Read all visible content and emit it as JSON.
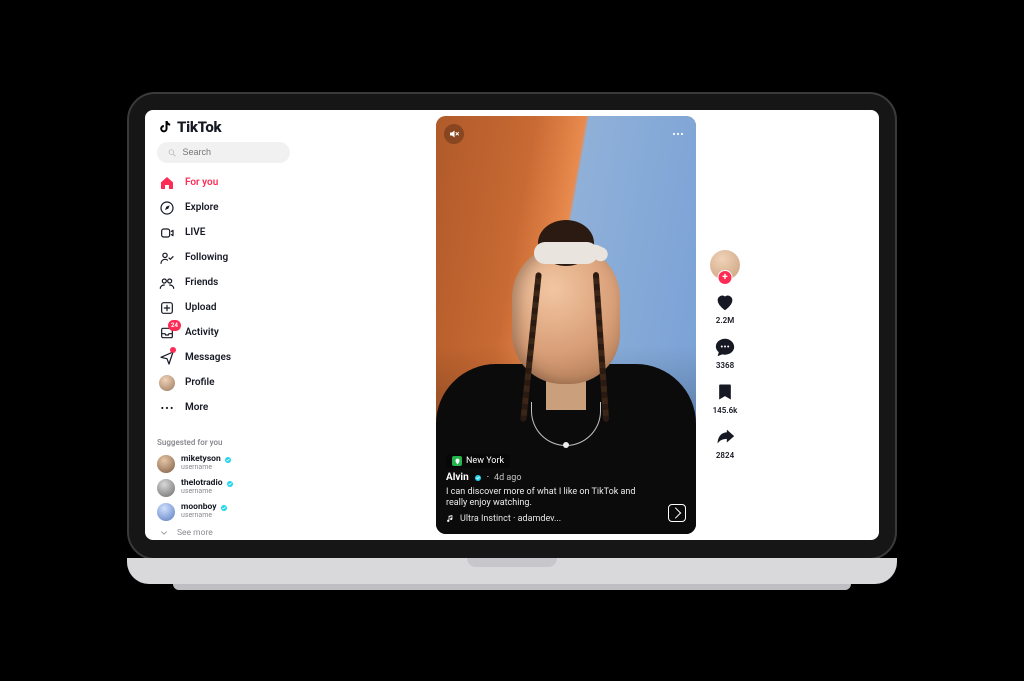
{
  "brand": "TikTok",
  "search": {
    "placeholder": "Search"
  },
  "nav": {
    "for_you": {
      "label": "For you"
    },
    "explore": {
      "label": "Explore"
    },
    "live": {
      "label": "LIVE"
    },
    "following": {
      "label": "Following"
    },
    "friends": {
      "label": "Friends"
    },
    "upload": {
      "label": "Upload"
    },
    "activity": {
      "label": "Activity",
      "badge": "24"
    },
    "messages": {
      "label": "Messages"
    },
    "profile": {
      "label": "Profile"
    },
    "more": {
      "label": "More"
    }
  },
  "suggested": {
    "title": "Suggested for you",
    "items": [
      {
        "name": "miketyson",
        "sub": "username"
      },
      {
        "name": "thelotradio",
        "sub": "username"
      },
      {
        "name": "moonboy",
        "sub": "username"
      }
    ],
    "see_more": "See more"
  },
  "video": {
    "location": "New York",
    "author": "Alvin",
    "time": "4d ago",
    "caption": "I can discover more of what I like on TikTok and really enjoy watching.",
    "sound": "Ultra Instinct · adamdev..."
  },
  "rail": {
    "likes": "2.2M",
    "comments": "3368",
    "saves": "145.6k",
    "shares": "2824"
  }
}
